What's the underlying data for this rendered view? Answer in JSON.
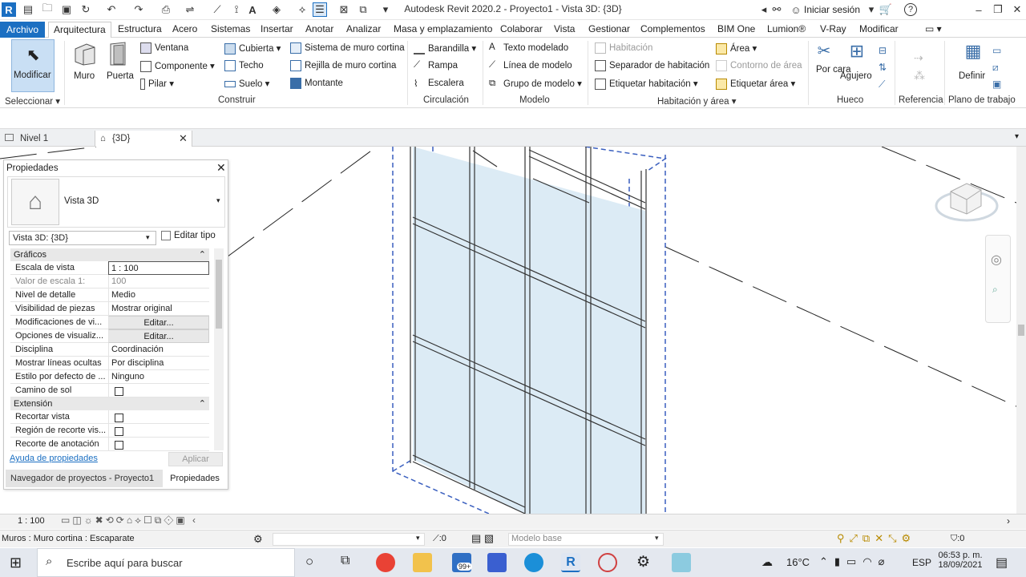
{
  "window": {
    "title": "Autodesk Revit 2020.2 - Proyecto1 - Vista 3D: {3D}",
    "sign_in": "Iniciar sesión",
    "help": "?"
  },
  "ribbon": {
    "tabs": [
      "Archivo",
      "Arquitectura",
      "Estructura",
      "Acero",
      "Sistemas",
      "Insertar",
      "Anotar",
      "Analizar",
      "Masa y emplazamiento",
      "Colaborar",
      "Vista",
      "Gestionar",
      "Complementos",
      "BIM One",
      "Lumion®",
      "V-Ray",
      "Modificar"
    ],
    "select": {
      "modificar": "Modificar",
      "group": "Seleccionar"
    },
    "construir": {
      "muro": "Muro",
      "puerta": "Puerta",
      "ventana": "Ventana",
      "componente": "Componente",
      "pilar": "Pilar",
      "cubierta": "Cubierta",
      "techo": "Techo",
      "suelo": "Suelo",
      "sistema_muro_cortina": "Sistema de muro cortina",
      "rejilla_muro_cortina": "Rejilla de muro cortina",
      "montante": "Montante",
      "group": "Construir"
    },
    "circulacion": {
      "barandilla": "Barandilla",
      "rampa": "Rampa",
      "escalera": "Escalera",
      "group": "Circulación"
    },
    "modelo": {
      "texto_modelado": "Texto modelado",
      "linea_modelo": "Línea de modelo",
      "grupo_modelo": "Grupo de modelo",
      "group": "Modelo"
    },
    "habitacion": {
      "habitacion": "Habitación",
      "separador": "Separador de habitación",
      "etiquetar_habitacion": "Etiquetar habitación",
      "area": "Área",
      "contorno_area": "Contorno de área",
      "etiquetar_area": "Etiquetar área",
      "group": "Habitación y área"
    },
    "hueco": {
      "por_cara": "Por cara",
      "agujero": "Agujero",
      "group": "Hueco"
    },
    "referencia": {
      "group": "Referencia"
    },
    "plano": {
      "definir": "Definir",
      "group": "Plano de trabajo"
    }
  },
  "view_tabs": [
    {
      "label": "Nivel 1"
    },
    {
      "label": "{3D}"
    }
  ],
  "properties": {
    "title": "Propiedades",
    "type_name": "Vista 3D",
    "selector": "Vista 3D: {3D}",
    "edit_type": "Editar tipo",
    "sections": {
      "graficos": "Gráficos",
      "extension": "Extensión"
    },
    "rows": [
      {
        "k": "Escala de vista",
        "v": "1 : 100"
      },
      {
        "k": "Valor de escala   1:",
        "v": "100"
      },
      {
        "k": "Nivel de detalle",
        "v": "Medio"
      },
      {
        "k": "Visibilidad de piezas",
        "v": "Mostrar original"
      },
      {
        "k": "Modificaciones de vi...",
        "v": "Editar..."
      },
      {
        "k": "Opciones de visualiz...",
        "v": "Editar..."
      },
      {
        "k": "Disciplina",
        "v": "Coordinación"
      },
      {
        "k": "Mostrar líneas ocultas",
        "v": "Por disciplina"
      },
      {
        "k": "Estilo por defecto de ...",
        "v": "Ninguno"
      },
      {
        "k": "Camino de sol",
        "v": ""
      }
    ],
    "ext_rows": [
      {
        "k": "Recortar vista"
      },
      {
        "k": "Región de recorte vis..."
      },
      {
        "k": "Recorte de anotación"
      }
    ],
    "help_link": "Ayuda de propiedades",
    "apply": "Aplicar",
    "bottom_tabs": [
      "Navegador de proyectos - Proyecto1",
      "Propiedades"
    ]
  },
  "statusbar": {
    "scale": "1 : 100"
  },
  "hintbar": {
    "status": "Muros : Muro cortina : Escaparate",
    "count": ":0",
    "model": "Modelo base",
    "filter": ":0"
  },
  "taskbar": {
    "search": "Escribe aquí para buscar",
    "temp": "16°C",
    "lang": "ESP",
    "time": "06:53 p. m.",
    "date": "18/09/2021",
    "mail_badge": "99+"
  },
  "colors": {
    "accent": "#1b6fc2",
    "glass": "#dcebf5",
    "frame": "#3a3a3a"
  }
}
